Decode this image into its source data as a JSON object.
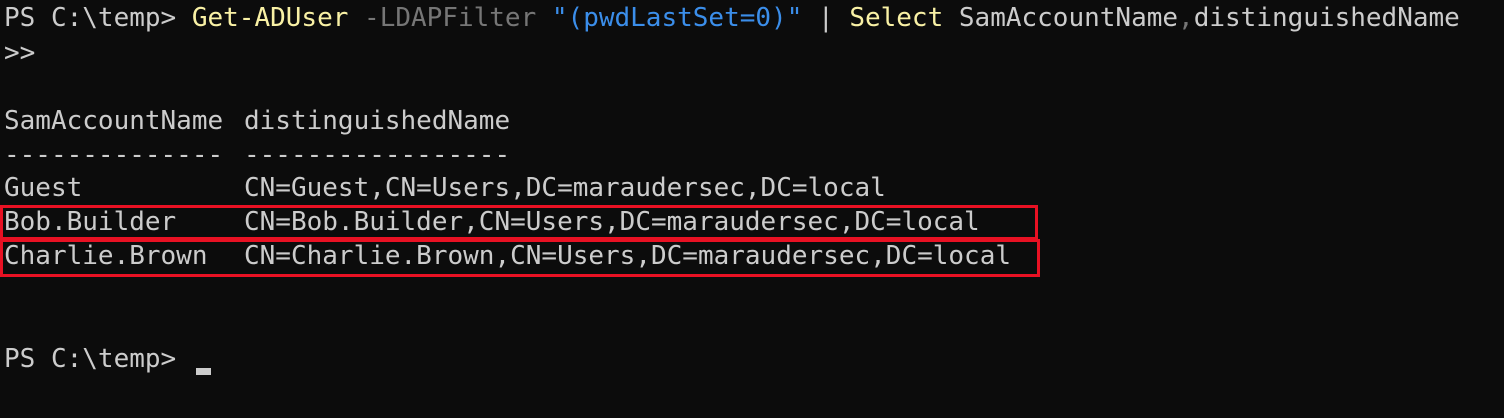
{
  "terminal": {
    "command_line": {
      "prompt": "PS C:\\temp> ",
      "cmdlet": "Get-ADUser",
      "param": " -LDAPFilter ",
      "filter": "\"(pwdLastSet=0)\"",
      "pipe": " | ",
      "select_cmd": "Select",
      "select_arg1": " SamAccountName",
      "comma": ",",
      "select_arg2": "distinguishedName"
    },
    "continuation": ">>",
    "table": {
      "headers": [
        "SamAccountName",
        "distinguishedName"
      ],
      "separators": [
        "--------------",
        "-----------------"
      ],
      "rows": [
        {
          "sam": "Guest",
          "dn": "CN=Guest,CN=Users,DC=maraudersec,DC=local"
        },
        {
          "sam": "Bob.Builder",
          "dn": "CN=Bob.Builder,CN=Users,DC=maraudersec,DC=local"
        },
        {
          "sam": "Charlie.Brown",
          "dn": "CN=Charlie.Brown,CN=Users,DC=maraudersec,DC=local"
        }
      ]
    },
    "final_prompt": "PS C:\\temp> ",
    "colors": {
      "background": "#0c0c0c",
      "foreground": "#cccccc",
      "cmdlet": "#f9f1a5",
      "parameter": "#767676",
      "string": "#3b8eea",
      "highlight_border": "#e81123"
    }
  }
}
